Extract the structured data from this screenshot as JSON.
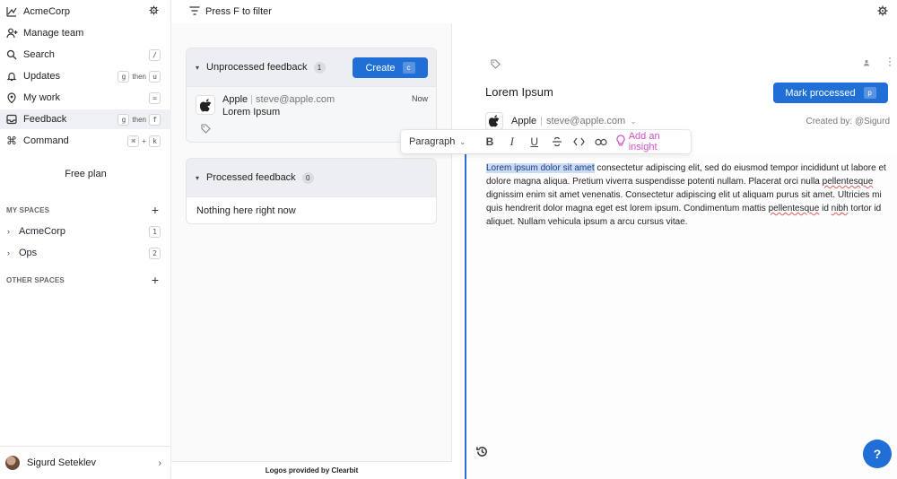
{
  "sidebar": {
    "workspace": "AcmeCorp",
    "nav": [
      {
        "label": "Manage team",
        "icon": "user-plus-icon"
      },
      {
        "label": "Search",
        "icon": "search-icon",
        "keys": [
          "/"
        ]
      },
      {
        "label": "Updates",
        "icon": "bell-icon",
        "keys": [
          "g",
          "u"
        ],
        "joiner": "then"
      },
      {
        "label": "My work",
        "icon": "target-icon",
        "keys": [
          "="
        ]
      },
      {
        "label": "Feedback",
        "icon": "inbox-icon",
        "keys": [
          "g",
          "f"
        ],
        "joiner": "then"
      },
      {
        "label": "Command",
        "icon": "command-icon",
        "keys": [
          "⌘",
          "k"
        ],
        "joiner": "+"
      }
    ],
    "free_plan": "Free plan",
    "my_spaces_header": "MY SPACES",
    "spaces": [
      {
        "label": "AcmeCorp",
        "key": "1"
      },
      {
        "label": "Ops",
        "key": "2"
      }
    ],
    "other_spaces_header": "OTHER SPACES",
    "user_name": "Sigurd Seteklev"
  },
  "middle": {
    "filter_label": "Press F to filter",
    "unprocessed": {
      "title": "Unprocessed feedback",
      "count": "1",
      "create_label": "Create",
      "create_key": "c",
      "items": [
        {
          "company": "Apple",
          "email": "steve@apple.com",
          "title": "Lorem Ipsum",
          "time": "Now"
        }
      ]
    },
    "processed": {
      "title": "Processed feedback",
      "count": "0",
      "empty": "Nothing here right now"
    },
    "footer": "Logos provided by Clearbit"
  },
  "detail": {
    "title": "Lorem Ipsum",
    "mark_label": "Mark processed",
    "mark_key": "p",
    "company": "Apple",
    "email": "steve@apple.com",
    "created_by": "Created by: @Sigurd",
    "text_selected": "Lorem ipsum dolor sit amet",
    "text_a": " consectetur adipiscing elit, sed do eiusmod tempor incididunt ut labore et dolore magna aliqua. Pretium viverra suspendisse potenti nullam. Placerat orci nulla ",
    "text_spell": "pellentesque",
    "text_b": " dignissim enim sit amet venenatis. Consectetur adipiscing elit ut aliquam purus sit amet. Ultricies mi quis hendrerit dolor magna eget est lorem ipsum. Condimentum mattis ",
    "text_spell2": "pellentesque",
    "text_c": " id ",
    "text_spell3": "nibh",
    "text_d": " tortor id aliquet. Nullam vehicula ipsum a arcu cursus vitae.",
    "help_label": "?"
  },
  "toolbar": {
    "paragraph": "Paragraph",
    "insight": "Add an insight"
  },
  "colors": {
    "accent": "#1f6fd6",
    "insight": "#d34fc9",
    "selection": "#c9dbf5"
  }
}
